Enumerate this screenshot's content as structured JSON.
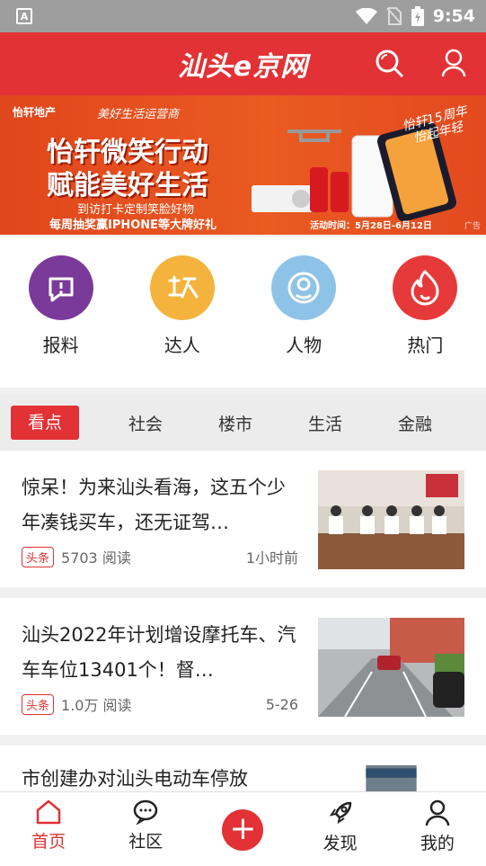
{
  "status_bar": {
    "time": "9:54",
    "left_icon": "A"
  },
  "header": {
    "logo": "汕头e京网"
  },
  "banner": {
    "brand": "怡轩地产",
    "brand_sub": "美好生活运营商",
    "headline1": "怡轩微笑行动",
    "headline2": "赋能美好生活",
    "sub1": "到访打卡定制笑脸好物",
    "sub2": "每周抽奖赢IPHONE等大牌好礼",
    "promo": "活动时间：5月28日-6月12日",
    "stamp1": "怡轩15周年",
    "stamp2": "怡起年轻",
    "ad_label": "广告"
  },
  "quick_entries": [
    {
      "label": "报料",
      "color": "#7a3a9a"
    },
    {
      "label": "达人",
      "color": "#f4b33c"
    },
    {
      "label": "人物",
      "color": "#8ec3e8"
    },
    {
      "label": "热门",
      "color": "#e63a3a"
    }
  ],
  "tabs": [
    "看点",
    "社会",
    "楼市",
    "生活",
    "金融"
  ],
  "news": [
    {
      "title": "惊呆！为来汕头看海，这五个少年凑钱买车，还无证驾…",
      "tag": "头条",
      "reads": "5703 阅读",
      "time": "1小时前"
    },
    {
      "title": "汕头2022年计划增设摩托车、汽车车位13401个！督…",
      "tag": "头条",
      "reads": "1.0万 阅读",
      "time": "5-26"
    },
    {
      "title": "市创建办对汕头电动车停放"
    }
  ],
  "bottom_nav": [
    {
      "label": "首页"
    },
    {
      "label": "社区"
    },
    {
      "label": "+"
    },
    {
      "label": "发现"
    },
    {
      "label": "我的"
    }
  ]
}
